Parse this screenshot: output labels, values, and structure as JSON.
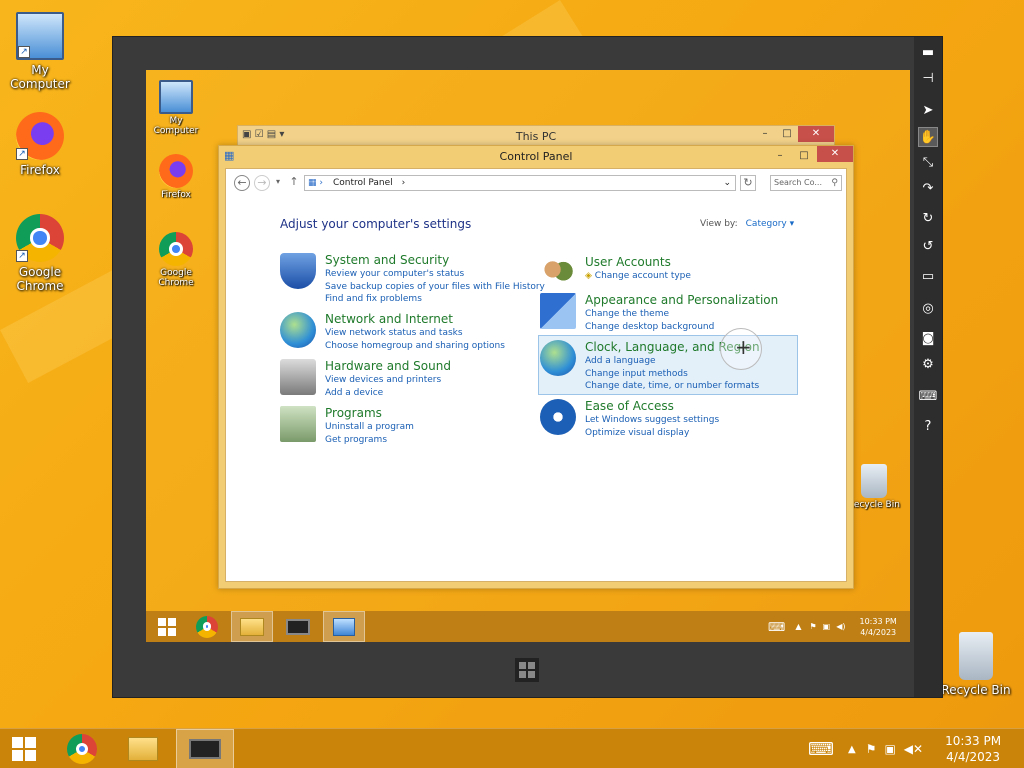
{
  "desktop": {
    "icons": [
      {
        "label": "My Computer"
      },
      {
        "label": "Firefox"
      },
      {
        "label": "Google Chrome"
      },
      {
        "label": "Recycle Bin"
      }
    ]
  },
  "taskbar": {
    "time": "10:33 PM",
    "date": "4/4/2023"
  },
  "vm": {
    "toolbar_icons": [
      "minimize-icon",
      "pin-icon",
      "pointer-icon",
      "hand-icon",
      "resize-icon",
      "redo-icon",
      "rotate-right-icon",
      "rotate-left-icon",
      "display-icon",
      "globe-icon",
      "camera-icon",
      "gear-icon",
      "keyboard-icon",
      "help-icon"
    ],
    "active_tool": "hand-icon",
    "help_label": "?"
  },
  "inner_desktop": {
    "icons": [
      {
        "label": "My Computer"
      },
      {
        "label": "Firefox"
      },
      {
        "label": "Google Chrome"
      },
      {
        "label": "Recycle Bin"
      }
    ]
  },
  "this_pc": {
    "title": "This PC"
  },
  "control_panel": {
    "title": "Control Panel",
    "breadcrumb": "Control Panel",
    "search_placeholder": "Search Co...",
    "heading": "Adjust your computer's settings",
    "view_by_label": "View by:",
    "view_by_value": "Category",
    "left": [
      {
        "title": "System and Security",
        "links": [
          "Review your computer's status",
          "Save backup copies of your files with File History",
          "Find and fix problems"
        ]
      },
      {
        "title": "Network and Internet",
        "links": [
          "View network status and tasks",
          "Choose homegroup and sharing options"
        ]
      },
      {
        "title": "Hardware and Sound",
        "links": [
          "View devices and printers",
          "Add a device"
        ]
      },
      {
        "title": "Programs",
        "links": [
          "Uninstall a program",
          "Get programs"
        ]
      }
    ],
    "right": [
      {
        "title": "User Accounts",
        "links": [
          "Change account type"
        ]
      },
      {
        "title": "Appearance and Personalization",
        "links": [
          "Change the theme",
          "Change desktop background"
        ]
      },
      {
        "title": "Clock, Language, and Region",
        "links": [
          "Add a language",
          "Change input methods",
          "Change date, time, or number formats"
        ]
      },
      {
        "title": "Ease of Access",
        "links": [
          "Let Windows suggest settings",
          "Optimize visual display"
        ]
      }
    ]
  },
  "inner_taskbar": {
    "time": "10:33 PM",
    "date": "4/4/2023"
  },
  "colors": {
    "wallpaper": "#f6b21b",
    "link": "#1a5fb4",
    "category_title": "#1f7a2b",
    "heading": "#1e3287"
  }
}
